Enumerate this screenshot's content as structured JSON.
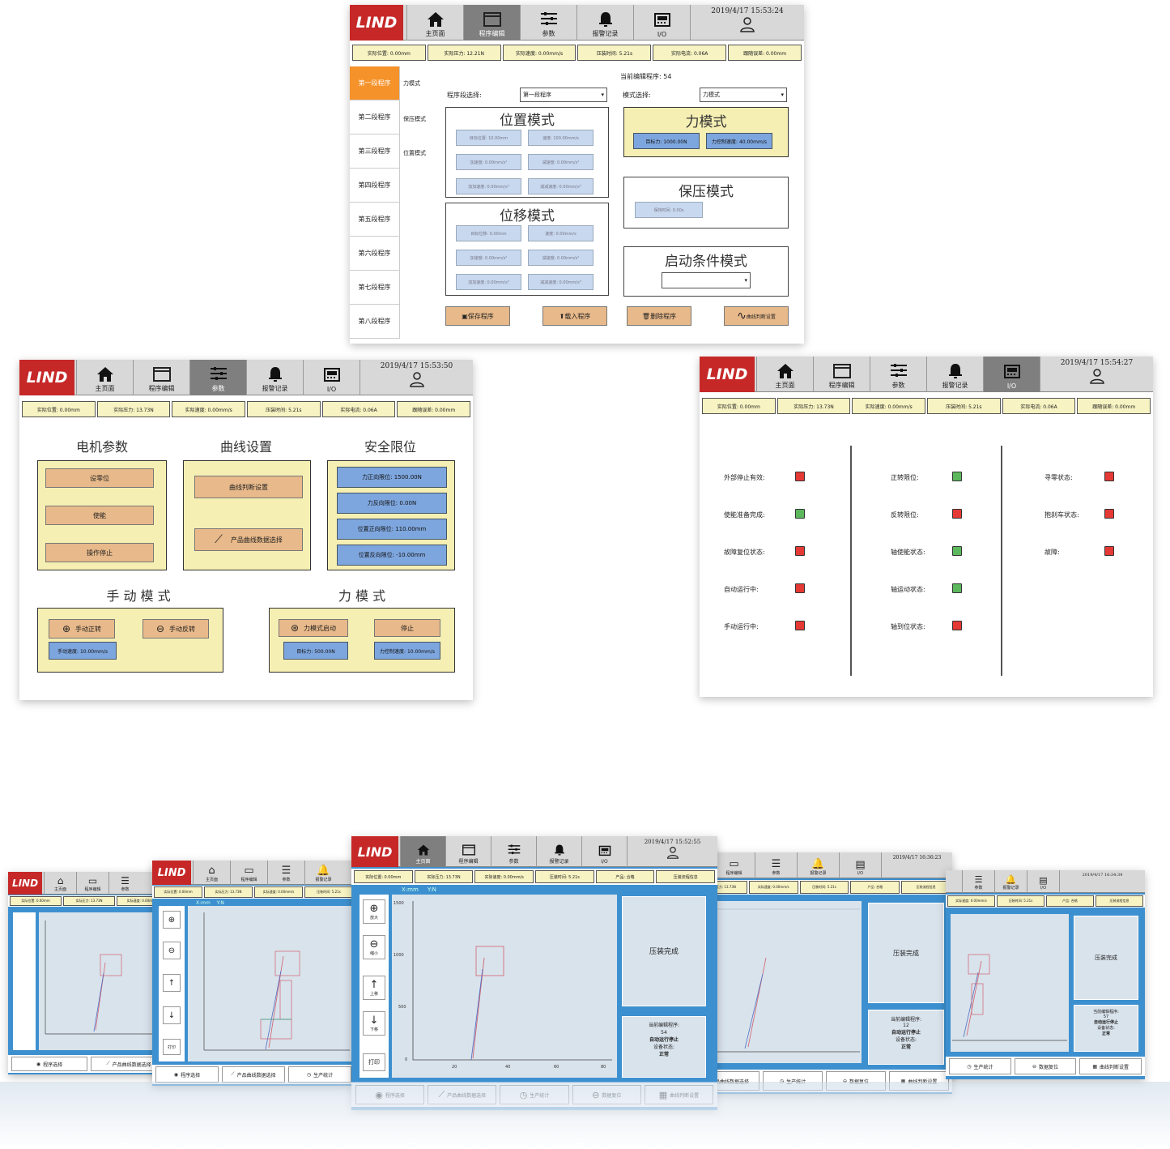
{
  "brand": {
    "logo": "LIND",
    "accent": "#c62828"
  },
  "nav": {
    "tabs": [
      {
        "label": "主页面",
        "icon": "home-icon"
      },
      {
        "label": "程序编辑",
        "icon": "window-icon"
      },
      {
        "label": "参数",
        "icon": "sliders-icon"
      },
      {
        "label": "报警记录",
        "icon": "bell-icon"
      },
      {
        "label": "I/O",
        "icon": "io-icon"
      }
    ]
  },
  "status_bar_1": [
    "实际位置: 0.00mm",
    "实际压力: 12.21N",
    "实际速度: 0.00mm/s",
    "压装时间: 5.21s",
    "实际电流: 0.06A",
    "跟随误差: 0.00mm"
  ],
  "status_bar_2": [
    "实际位置: 0.00mm",
    "实际压力: 13.73N",
    "实际速度: 0.00mm/s",
    "压装时间: 5.21s",
    "实际电流: 0.06A",
    "跟随误差: 0.00mm"
  ],
  "program_editor": {
    "time": "2019/4/17 15:53:24",
    "segments": [
      "第一段程序",
      "第二段程序",
      "第三段程序",
      "第四段程序",
      "第五段程序",
      "第六段程序",
      "第七段程序",
      "第八段程序"
    ],
    "segment_modes": [
      "力模式",
      "保压模式",
      "位置模式"
    ],
    "current_program": "当前编辑程序: 54",
    "seg_select_label": "程序段选择:",
    "seg_select_value": "第一段程序",
    "mode_select_label": "模式选择:",
    "mode_select_value": "力模式",
    "position_mode": {
      "title": "位置模式",
      "fields": [
        "目标位置: 10.00mm",
        "速度: 100.00mm/s",
        "加速度: 0.00mm/s²",
        "减速度: 0.00mm/s²",
        "加加速度: 0.00mm/s³",
        "减减速度: 0.00mm/s³"
      ]
    },
    "displacement_mode": {
      "title": "位移模式",
      "fields": [
        "目标位移: 0.00mm",
        "速度: 0.00mm/s",
        "加速度: 0.00mm/s²",
        "减速度: 0.00mm/s²",
        "加加速度: 0.00mm/s³",
        "减减速度: 0.00mm/s³"
      ]
    },
    "force_mode": {
      "title": "力模式",
      "fields": [
        "目标力: 1000.00N",
        "力控制速度: 40.00mm/s"
      ]
    },
    "hold_mode": {
      "title": "保压模式",
      "fields": [
        "保持时间: 0.00s"
      ]
    },
    "start_mode": {
      "title": "启动条件模式"
    },
    "buttons": [
      "保存程序",
      "载入程序",
      "删除程序",
      "曲线判断设置"
    ]
  },
  "params": {
    "time": "2019/4/17 15:53:50",
    "motor": {
      "title": "电机参数",
      "buttons": [
        "设零位",
        "使能",
        "操作停止"
      ]
    },
    "curve": {
      "title": "曲线设置",
      "buttons": [
        "曲线判断设置",
        "产品曲线数据选择"
      ]
    },
    "safety": {
      "title": "安全限位",
      "fields": [
        "力正向限位: 1500.00N",
        "力反向限位: 0.00N",
        "位置正向限位: 110.00mm",
        "位置反向限位: -10.00mm"
      ]
    },
    "manual": {
      "title": "手 动 模 式",
      "buttons": [
        "手动正转",
        "手动反转"
      ],
      "field": "手动速度: 10.00mm/s"
    },
    "force": {
      "title": "力 模 式",
      "buttons": [
        "力模式启动",
        "停止"
      ],
      "fields": [
        "目标力: 500.00N",
        "力控制速度: 10.00mm/s"
      ]
    }
  },
  "io": {
    "time": "2019/4/17 15:54:27",
    "col1": [
      {
        "label": "外部停止有效:",
        "state": "r"
      },
      {
        "label": "使能准备完成:",
        "state": "g"
      },
      {
        "label": "故障复位状态:",
        "state": "r"
      },
      {
        "label": "自动运行中:",
        "state": "r"
      },
      {
        "label": "手动运行中:",
        "state": "r"
      }
    ],
    "col2": [
      {
        "label": "正转限位:",
        "state": "g"
      },
      {
        "label": "反转限位:",
        "state": "r"
      },
      {
        "label": "轴使能状态:",
        "state": "g"
      },
      {
        "label": "轴运动状态:",
        "state": "g"
      },
      {
        "label": "轴到位状态:",
        "state": "r"
      }
    ],
    "col3": [
      {
        "label": "寻零状态:",
        "state": "r"
      },
      {
        "label": "抱刹车状态:",
        "state": "r"
      },
      {
        "label": "故障:",
        "state": "r"
      }
    ]
  },
  "main_screen": {
    "time": "2019/4/17 15:52:55",
    "status": [
      "实际位置: 0.00mm",
      "实际压力: 13.73N",
      "实际速度: 0.00mm/s",
      "压装时间: 5.21s",
      "产品: 合格",
      "压装流程信息"
    ],
    "axis": {
      "x_label": "X:mm",
      "y_label": "Y:N"
    },
    "tools": [
      "放大",
      "缩小",
      "上移",
      "下移",
      "打印"
    ],
    "result": "压装完成",
    "current_program": "当前编辑程序:",
    "program_no": "54",
    "run_state": "自动运行停止",
    "device_state_label": "设备状态:",
    "device_state": "正常",
    "bottom": [
      "程序选择",
      "产品曲线数据选择",
      "生产统计",
      "数据复位",
      "曲线判断设置"
    ]
  },
  "side_screens": {
    "time_right": "2019/4/17 16:36:23",
    "time_far_right": "2019/4/17 16:34:34",
    "program_no_right": "12",
    "program_no_far_right": "57"
  }
}
